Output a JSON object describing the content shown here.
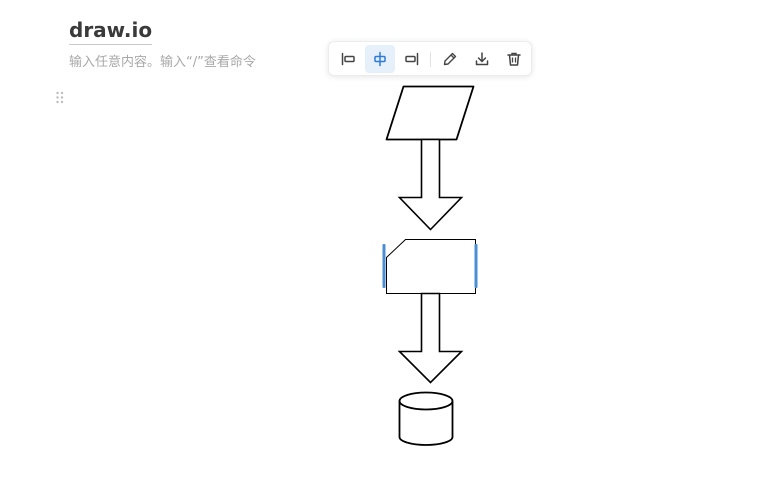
{
  "document": {
    "title": "draw.io",
    "placeholder": "输入任意内容。输入“/”查看命令"
  },
  "toolbar": {
    "buttons": [
      {
        "icon": "align-left-icon",
        "action": "align-left",
        "active": false
      },
      {
        "icon": "align-center-icon",
        "action": "align-center",
        "active": true
      },
      {
        "icon": "align-right-icon",
        "action": "align-right",
        "active": false
      },
      {
        "icon": "pencil-icon",
        "action": "edit",
        "active": false
      },
      {
        "icon": "download-icon",
        "action": "download",
        "active": false
      },
      {
        "icon": "trash-icon",
        "action": "delete",
        "active": false
      }
    ]
  },
  "diagram": {
    "shapes": [
      "parallelogram",
      "down-arrow",
      "card",
      "down-arrow",
      "cylinder"
    ],
    "selection_color": "#4a8fd6"
  },
  "colors": {
    "accent": "#2f7bd8",
    "accent_bg": "#e6f0fb",
    "icon": "#444444",
    "placeholder": "#a8a8a8",
    "title": "#3a3a3a"
  }
}
